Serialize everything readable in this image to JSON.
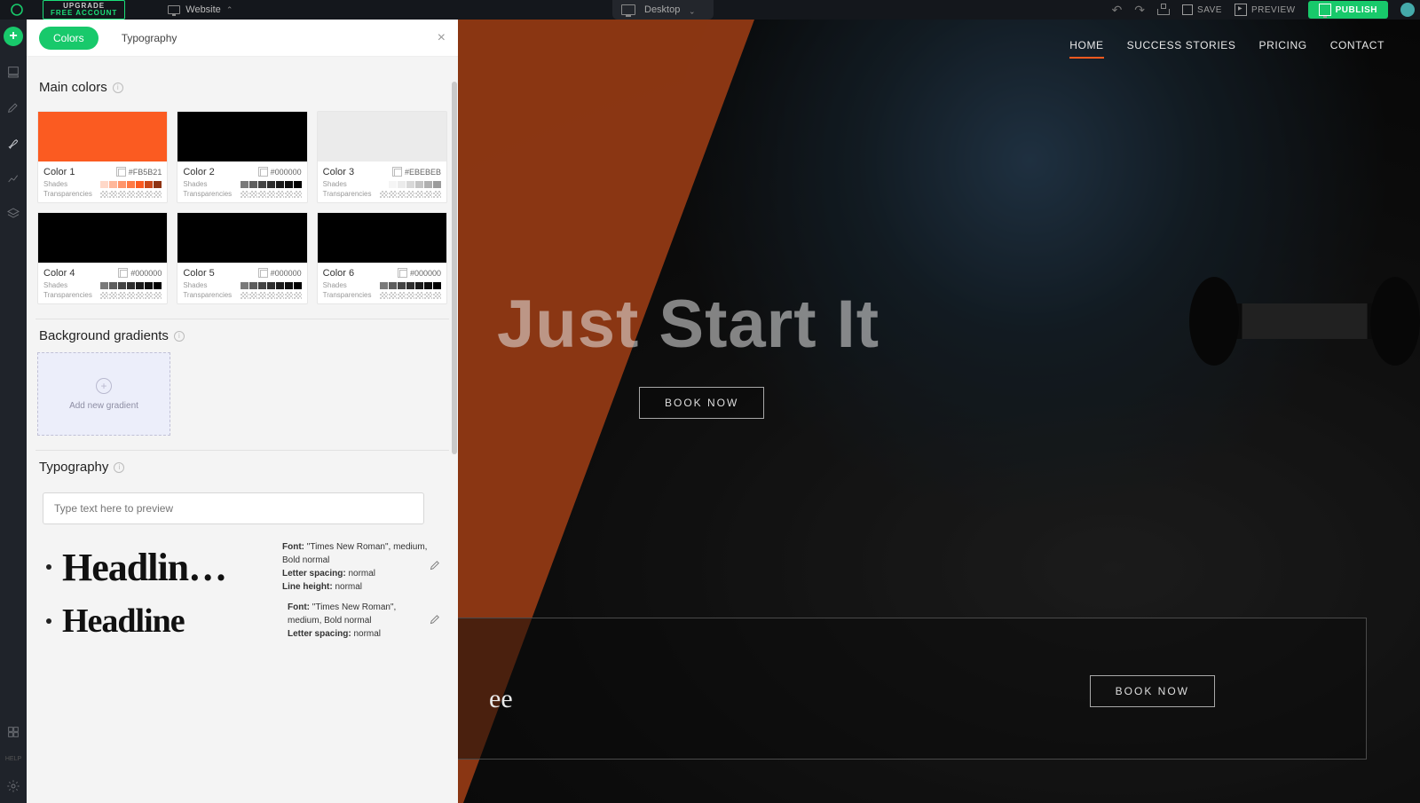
{
  "topbar": {
    "upgrade_line1": "UPGRADE",
    "upgrade_line2": "FREE ACCOUNT",
    "scope_label": "Website",
    "device_label": "Desktop",
    "save_label": "SAVE",
    "preview_label": "PREVIEW",
    "publish_label": "PUBLISH"
  },
  "panel": {
    "tab_colors": "Colors",
    "tab_typography": "Typography",
    "main_colors_title": "Main colors",
    "bg_gradients_title": "Background gradients",
    "typography_title": "Typography",
    "add_gradient_label": "Add new gradient",
    "preview_placeholder": "Type text here to preview",
    "shades_label": "Shades",
    "transparencies_label": "Transparencies",
    "colors": [
      {
        "name": "Color 1",
        "hex": "#FB5B21",
        "swatch": "#FB5B21",
        "shades": [
          "#ffd8c8",
          "#ffb79a",
          "#ff956b",
          "#ff7a45",
          "#fb5b21",
          "#c9481a",
          "#8f3312"
        ]
      },
      {
        "name": "Color 2",
        "hex": "#000000",
        "swatch": "#000000",
        "shades": [
          "#7a7a7a",
          "#5e5e5e",
          "#444444",
          "#2e2e2e",
          "#1a1a1a",
          "#0d0d0d",
          "#000000"
        ]
      },
      {
        "name": "Color 3",
        "hex": "#EBEBEB",
        "swatch": "#EBEBEB",
        "shades": [
          "#ffffff",
          "#f5f5f5",
          "#ebebeb",
          "#d8d8d8",
          "#c4c4c4",
          "#b0b0b0",
          "#9c9c9c"
        ]
      },
      {
        "name": "Color 4",
        "hex": "#000000",
        "swatch": "#000000",
        "shades": [
          "#7a7a7a",
          "#5e5e5e",
          "#444444",
          "#2e2e2e",
          "#1a1a1a",
          "#0d0d0d",
          "#000000"
        ]
      },
      {
        "name": "Color 5",
        "hex": "#000000",
        "swatch": "#000000",
        "shades": [
          "#7a7a7a",
          "#5e5e5e",
          "#444444",
          "#2e2e2e",
          "#1a1a1a",
          "#0d0d0d",
          "#000000"
        ]
      },
      {
        "name": "Color 6",
        "hex": "#000000",
        "swatch": "#000000",
        "shades": [
          "#7a7a7a",
          "#5e5e5e",
          "#444444",
          "#2e2e2e",
          "#1a1a1a",
          "#0d0d0d",
          "#000000"
        ]
      }
    ],
    "typo_font_label": "Font:",
    "typo_font_value": " \"Times New Roman\", medium, Bold normal",
    "typo_letter_label": "Letter spacing:",
    "typo_letter_value": " normal",
    "typo_line_label": "Line height:",
    "typo_line_value": " normal",
    "headline1_sample": "Headlin…",
    "headline2_sample": "Headline "
  },
  "site": {
    "nav": [
      "HOME",
      "SUCCESS STORIES",
      "PRICING",
      "CONTACT"
    ],
    "hero_title": "Just Start It",
    "book_now": "BOOK NOW",
    "free_text": "ee",
    "book_now2": "BOOK NOW"
  }
}
